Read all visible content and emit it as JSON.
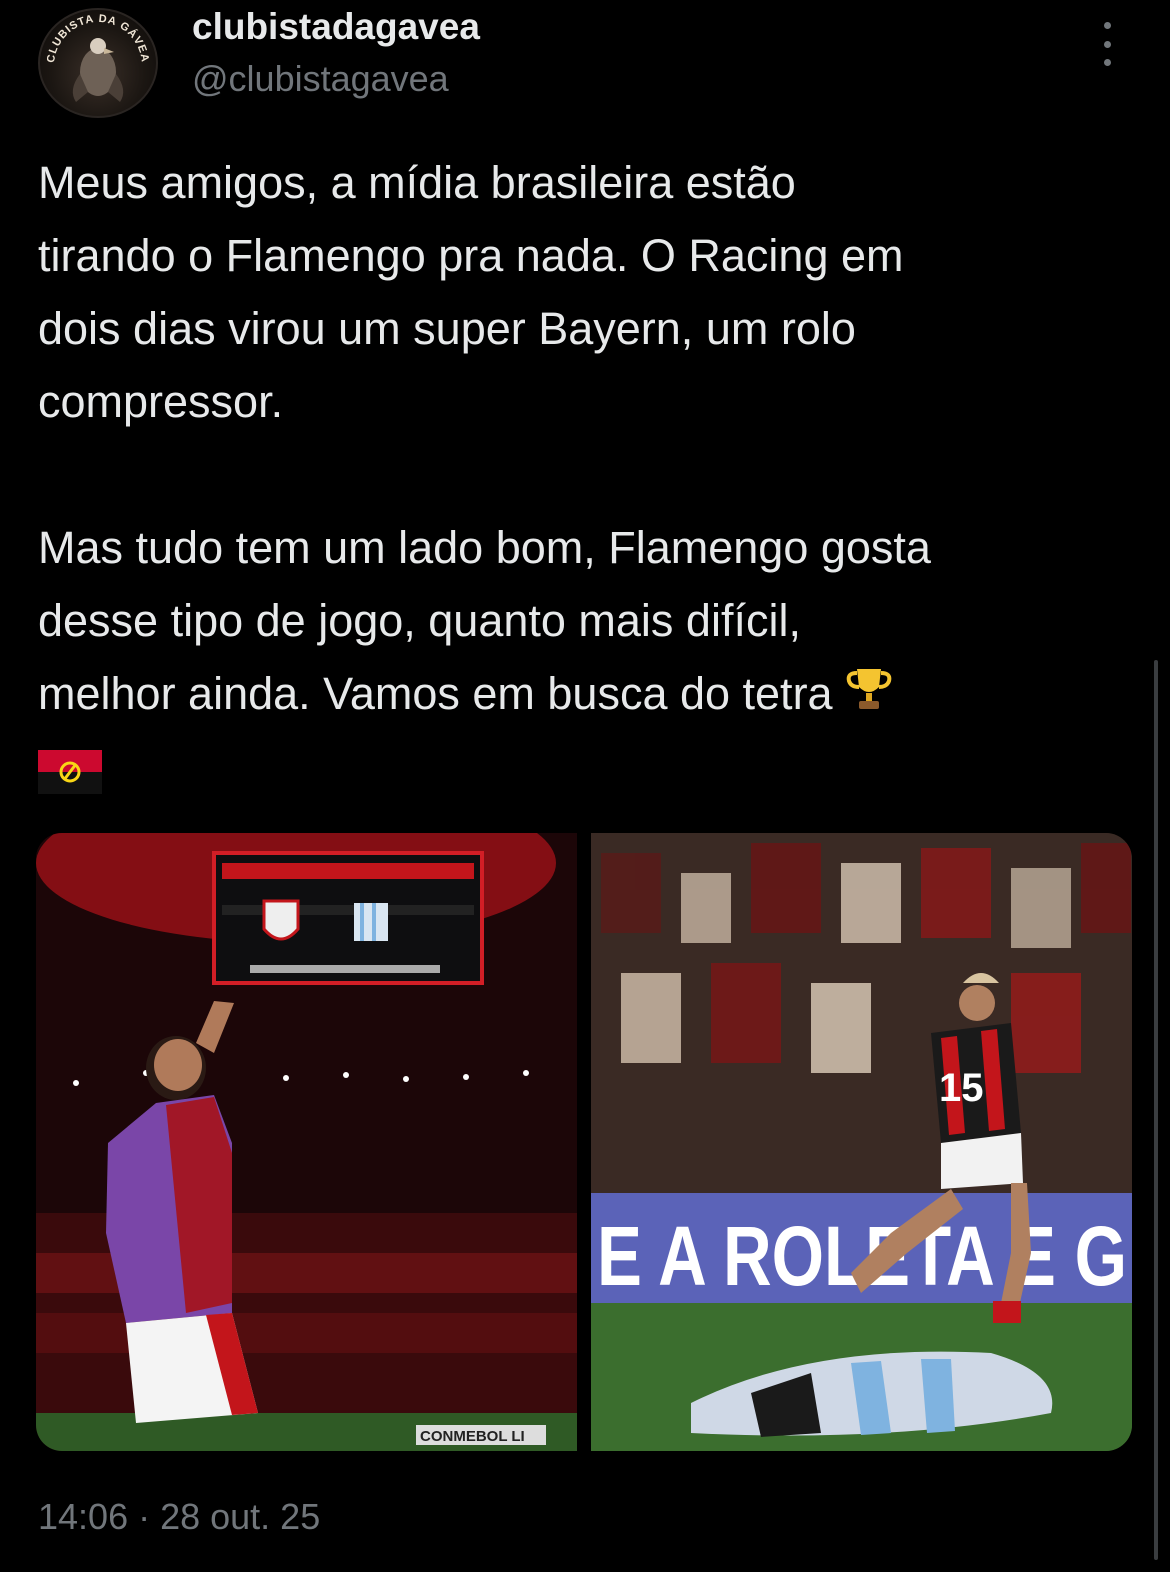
{
  "author": {
    "display_name": "clubistadagavea",
    "handle": "@clubistagavea",
    "avatar_text": "CLUBISTA DA GÁVEA"
  },
  "tweet": {
    "lines": [
      "Meus amigos, a mídia brasileira estão",
      "tirando o Flamengo pra nada. O Racing em",
      "dois dias virou um super Bayern, um rolo",
      "compressor.",
      "",
      "Mas tudo tem um lado bom, Flamengo gosta",
      "desse tipo de jogo, quanto mais difícil,",
      "melhor ainda. Vamos em busca do tetra"
    ],
    "emojis": [
      "trophy-emoji",
      "angola-flag-emoji"
    ],
    "timestamp": "14:06 · 28 out. 25"
  },
  "media": {
    "photo_left": {
      "icon": "stadium-photo",
      "visible_text": [
        "CONMEBOL LI"
      ]
    },
    "photo_right": {
      "icon": "player-celebration-photo",
      "visible_text": [
        "E A ROLETA E G",
        "15"
      ]
    }
  },
  "colors": {
    "background": "#000000",
    "text_primary": "#e7e9ea",
    "text_secondary": "#71767b",
    "flamengo_red": "#c3151b"
  }
}
